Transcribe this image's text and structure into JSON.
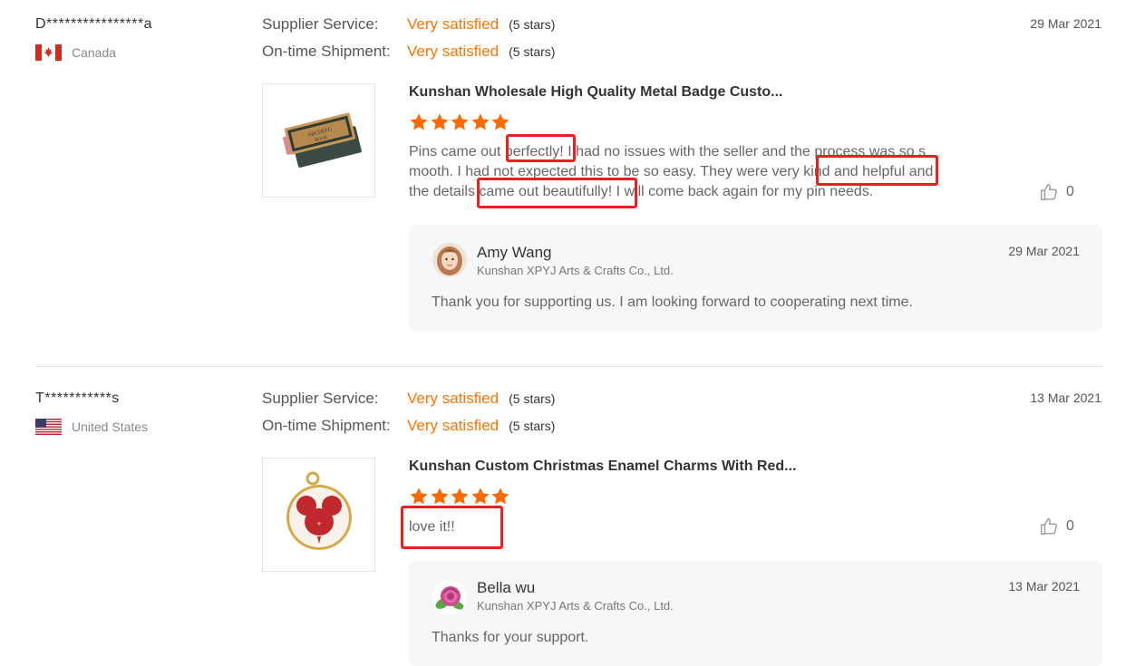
{
  "reviews": [
    {
      "reviewer": "D****************a",
      "country": "Canada",
      "flag_icon": "canada-flag-icon",
      "supplier_service_label": "Supplier Service:",
      "supplier_service_value": "Very satisfied",
      "supplier_service_stars": "(5 stars)",
      "shipment_label": "On-time Shipment:",
      "shipment_value": "Very satisfied",
      "shipment_stars": "(5 stars)",
      "date": "29 Mar 2021",
      "product_title": "Kunshan Wholesale High Quality Metal Badge Custo...",
      "rating": 5,
      "text_line1": "Pins came out perfectly! I had no issues with the seller and the process was so s",
      "text_line2": "mooth. I had not expected this to be so easy. They were very kind and helpful and",
      "text_line3": "the details came out beautifully! I will come back again for my pin needs.",
      "likes": "0",
      "reply": {
        "name": "Amy Wang",
        "company": "Kunshan XPYJ Arts & Crafts Co., Ltd.",
        "date": "29 Mar 2021",
        "text": "Thank you for supporting us. I  am looking forward to cooperating next time."
      }
    },
    {
      "reviewer": "T***********s",
      "country": "United States",
      "flag_icon": "usa-flag-icon",
      "supplier_service_label": "Supplier Service:",
      "supplier_service_value": "Very satisfied",
      "supplier_service_stars": "(5 stars)",
      "shipment_label": "On-time Shipment:",
      "shipment_value": "Very satisfied",
      "shipment_stars": "(5 stars)",
      "date": "13 Mar 2021",
      "product_title": "Kunshan Custom Christmas Enamel Charms With Red...",
      "rating": 5,
      "text": "love it!!",
      "likes": "0",
      "reply": {
        "name": "Bella wu",
        "company": "Kunshan XPYJ Arts & Crafts Co., Ltd.",
        "date": "13 Mar 2021",
        "text": "Thanks for your support."
      }
    }
  ],
  "colors": {
    "accent": "#ff7300",
    "highlight": "#e8211f",
    "reply_bg": "#f6f7f9"
  }
}
